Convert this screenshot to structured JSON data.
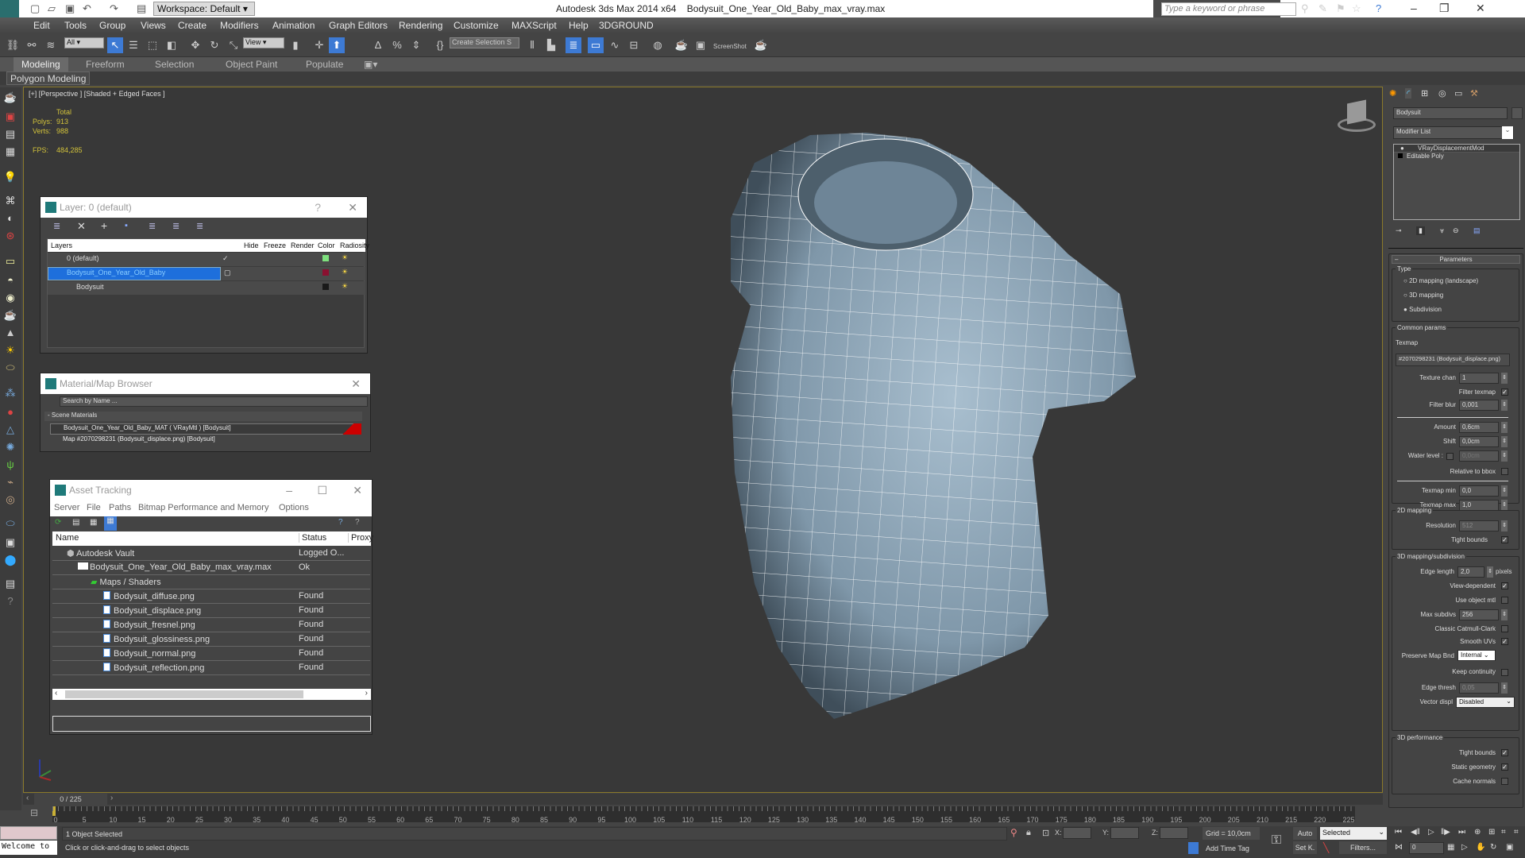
{
  "titlebar": {
    "app_title": "Autodesk 3ds Max  2014 x64",
    "file_title": "Bodysuit_One_Year_Old_Baby_max_vray.max",
    "workspace": "Workspace: Default",
    "search_placeholder": "Type a keyword or phrase"
  },
  "menu": [
    "Edit",
    "Tools",
    "Group",
    "Views",
    "Create",
    "Modifiers",
    "Animation",
    "Graph Editors",
    "Rendering",
    "Customize",
    "MAXScript",
    "Help",
    "3DGROUND"
  ],
  "toolbar": {
    "selection_filter": "All",
    "ref_coord": "View",
    "named_selection": "Create Selection S",
    "screenshot_label": "ScreenShot"
  },
  "ribbon": {
    "tabs": [
      "Modeling",
      "Freeform",
      "Selection",
      "Object Paint",
      "Populate"
    ],
    "active": "Modeling",
    "sub_label": "Polygon Modeling"
  },
  "viewport": {
    "label": "[+] [Perspective ] [Shaded + Edged Faces ]",
    "stats": {
      "header": "Total",
      "polys_label": "Polys:",
      "polys": "913",
      "verts_label": "Verts:",
      "verts": "988",
      "fps_label": "FPS:",
      "fps": "484,285"
    }
  },
  "layer_panel": {
    "title": "Layer: 0 (default)",
    "help": "?",
    "columns": [
      "Layers",
      "Hide",
      "Freeze",
      "Render",
      "Color",
      "Radiosity"
    ],
    "rows": [
      {
        "name": "0 (default)",
        "color": "#7ee07e",
        "current": true
      },
      {
        "name": "Bodysuit_One_Year_Old_Baby",
        "color": "#8a1030",
        "selected": true
      },
      {
        "name": "Bodysuit",
        "color": "#1a1a1a"
      }
    ]
  },
  "material_browser": {
    "title": "Material/Map Browser",
    "search_placeholder": "Search by Name ...",
    "group": "- Scene Materials",
    "items": [
      "Bodysuit_One_Year_Old_Baby_MAT  ( VRayMtl ) [Bodysuit]",
      "Map #2070298231 (Bodysuit_displace.png) [Bodysuit]"
    ]
  },
  "asset_tracking": {
    "title": "Asset Tracking",
    "menu": [
      "Server",
      "File",
      "Paths",
      "Bitmap Performance and Memory",
      "Options"
    ],
    "columns": [
      "Name",
      "Status",
      "Proxy"
    ],
    "rows": [
      {
        "name": "Autodesk Vault",
        "status": "Logged O...",
        "indent": 1
      },
      {
        "name": "Bodysuit_One_Year_Old_Baby_max_vray.max",
        "status": "Ok",
        "indent": 2
      },
      {
        "name": "Maps / Shaders",
        "status": "",
        "indent": 3
      },
      {
        "name": "Bodysuit_diffuse.png",
        "status": "Found",
        "indent": 4
      },
      {
        "name": "Bodysuit_displace.png",
        "status": "Found",
        "indent": 4
      },
      {
        "name": "Bodysuit_fresnel.png",
        "status": "Found",
        "indent": 4
      },
      {
        "name": "Bodysuit_glossiness.png",
        "status": "Found",
        "indent": 4
      },
      {
        "name": "Bodysuit_normal.png",
        "status": "Found",
        "indent": 4
      },
      {
        "name": "Bodysuit_reflection.png",
        "status": "Found",
        "indent": 4
      }
    ]
  },
  "command_panel": {
    "object_name": "Bodysuit",
    "modifier_list": "Modifier List",
    "stack": [
      "VRayDisplacementMod",
      "Editable Poly"
    ],
    "rollout": "Parameters",
    "type_group": "Type",
    "type_options": [
      "2D mapping (landscape)",
      "3D mapping",
      "Subdivision"
    ],
    "type_selected": "Subdivision",
    "common_group": "Common params",
    "texmap_label": "Texmap",
    "texmap": "#2070298231 (Bodysuit_displace.png)",
    "texture_chan_label": "Texture chan",
    "texture_chan": "1",
    "filter_texmap_label": "Filter texmap",
    "filter_texmap": true,
    "filter_blur_label": "Filter blur",
    "filter_blur": "0,001",
    "amount_label": "Amount",
    "amount": "0,6cm",
    "shift_label": "Shift",
    "shift": "0,0cm",
    "water_level_label": "Water level :",
    "water_level": "0,0cm",
    "relative_bbox_label": "Relative to bbox",
    "texmap_min_label": "Texmap min",
    "texmap_min": "0,0",
    "texmap_max_label": "Texmap max",
    "texmap_max": "1,0",
    "map2d_group": "2D mapping",
    "resolution_label": "Resolution",
    "resolution": "512",
    "tight_bounds_label": "Tight bounds",
    "map3d_group": "3D mapping/subdivision",
    "edge_length_label": "Edge length",
    "edge_length": "2,0",
    "pixels": "pixels",
    "view_dependent_label": "View-dependent",
    "use_object_mtl_label": "Use object mtl",
    "max_subdivs_label": "Max subdivs",
    "max_subdivs": "256",
    "catmull_label": "Classic Catmull-Clark",
    "smooth_uvs_label": "Smooth UVs",
    "preserve_label": "Preserve Map Bnd",
    "preserve": "Internal",
    "keep_continuity_label": "Keep continuity",
    "edge_thresh_label": "Edge thresh",
    "edge_thresh": "0,05",
    "vector_displ_label": "Vector displ",
    "vector_displ": "Disabled",
    "perf_group": "3D performance",
    "perf_tight_label": "Tight bounds",
    "static_geo_label": "Static geometry",
    "cache_normals_label": "Cache normals"
  },
  "timeline": {
    "frame": "0 / 225",
    "ticks": [
      0,
      5,
      10,
      15,
      20,
      25,
      30,
      35,
      40,
      45,
      50,
      55,
      60,
      65,
      70,
      75,
      80,
      85,
      90,
      95,
      100,
      105,
      110,
      115,
      120,
      125,
      130,
      135,
      140,
      145,
      150,
      155,
      160,
      165,
      170,
      175,
      180,
      185,
      190,
      195,
      200,
      205,
      210,
      215,
      220,
      225
    ]
  },
  "status": {
    "maxscript": "Welcome to",
    "selected": "1 Object Selected",
    "prompt": "Click or click-and-drag to select objects",
    "x_label": "X:",
    "y_label": "Y:",
    "z_label": "Z:",
    "grid": "Grid = 10,0cm",
    "add_time_tag": "Add Time Tag",
    "auto": "Auto",
    "setk": "Set K.",
    "key_filter": "Selected",
    "filters": "Filters...",
    "current_frame": "0"
  }
}
